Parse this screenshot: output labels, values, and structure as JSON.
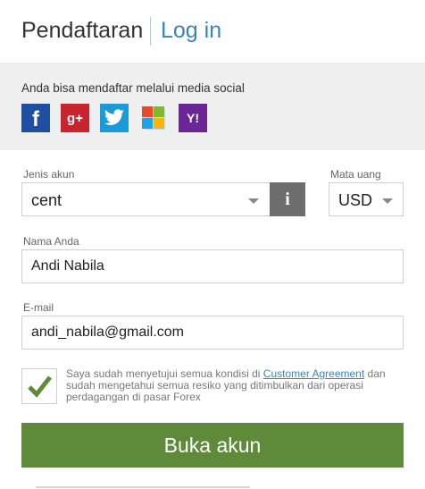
{
  "header": {
    "register_tab": "Pendaftaran",
    "login_tab": "Log in"
  },
  "social": {
    "prompt": "Anda bisa mendaftar melalui media social",
    "icons": [
      "facebook-icon",
      "google-plus-icon",
      "twitter-icon",
      "microsoft-icon",
      "yahoo-icon"
    ],
    "fb_glyph": "f",
    "gp_glyph": "g+",
    "yh_glyph": "Y!"
  },
  "form": {
    "account_type": {
      "label": "Jenis akun",
      "value": "cent"
    },
    "currency": {
      "label": "Mata uang",
      "value": "USD"
    },
    "info_glyph": "i",
    "name": {
      "label": "Nama Anda",
      "value": "Andi Nabila"
    },
    "email": {
      "label": "E-mail",
      "value": "andi_nabila@gmail.com"
    },
    "agreement": {
      "checked": true,
      "text_before": "Saya sudah menyetujui semua kondisi di ",
      "link": "Customer Agreement",
      "text_after": " dan sudah mengetahui semua resiko yang ditimbulkan dari operasi perdagangan di pasar Forex"
    },
    "submit_label": "Buka akun"
  },
  "colors": {
    "accent_link": "#3b84b4",
    "submit_green": "#5e8a3a",
    "social_bg": "#efefef"
  }
}
